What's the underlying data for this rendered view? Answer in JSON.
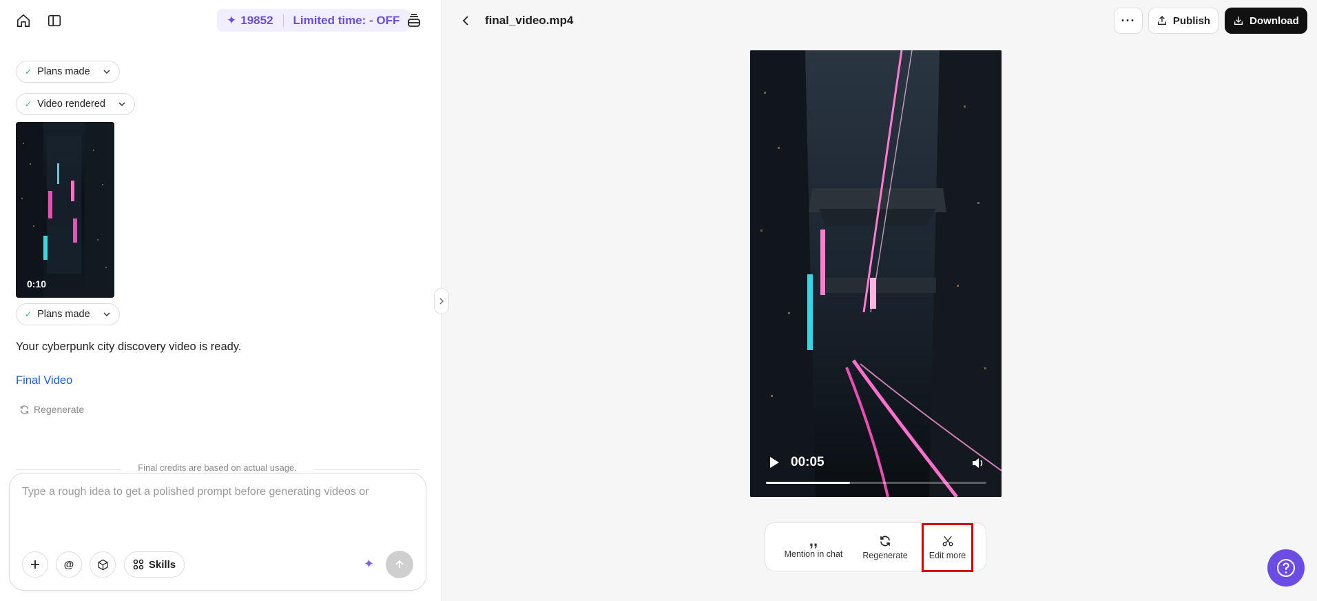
{
  "left_panel": {
    "credits": {
      "amount": "19852",
      "promo": "Limited time: - OFF"
    },
    "steps": [
      {
        "label": "Plans made"
      },
      {
        "label": "Video rendered"
      },
      {
        "label": "Plans made"
      }
    ],
    "thumbnail": {
      "duration": "0:10"
    },
    "message": "Your cyberpunk city discovery video is ready.",
    "link_text": "Final Video",
    "regenerate_label": "Regenerate",
    "credits_note": "Final credits are based on actual usage.",
    "composer": {
      "placeholder": "Type a rough idea to get a polished prompt before generating videos or",
      "skills_label": "Skills"
    }
  },
  "right_panel": {
    "filename": "final_video.mp4",
    "publish_label": "Publish",
    "download_label": "Download",
    "video": {
      "current_time": "00:05",
      "progress": 0.38
    },
    "actions": [
      {
        "label": "Mention in chat",
        "icon": "quote-icon"
      },
      {
        "label": "Regenerate",
        "icon": "refresh-icon"
      },
      {
        "label": "Edit more",
        "icon": "scissors-icon"
      }
    ]
  },
  "colors": {
    "accent": "#6b4de6",
    "link": "#1a5fd6",
    "highlight": "#e00000"
  }
}
